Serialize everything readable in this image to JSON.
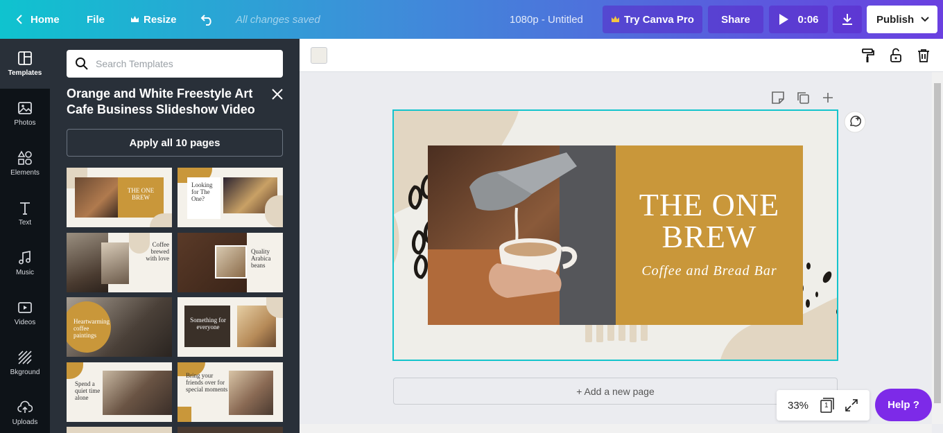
{
  "topbar": {
    "home": "Home",
    "file": "File",
    "resize": "Resize",
    "saved_status": "All changes saved",
    "doc_title": "1080p - Untitled",
    "try_pro": "Try Canva Pro",
    "share": "Share",
    "play_time": "0:06",
    "publish": "Publish"
  },
  "rail": {
    "items": [
      {
        "label": "Templates",
        "icon": "templates-icon"
      },
      {
        "label": "Photos",
        "icon": "photos-icon"
      },
      {
        "label": "Elements",
        "icon": "elements-icon"
      },
      {
        "label": "Text",
        "icon": "text-icon"
      },
      {
        "label": "Music",
        "icon": "music-icon"
      },
      {
        "label": "Videos",
        "icon": "videos-icon"
      },
      {
        "label": "Bkground",
        "icon": "background-icon"
      },
      {
        "label": "Uploads",
        "icon": "uploads-icon"
      }
    ]
  },
  "panel": {
    "search_placeholder": "Search Templates",
    "template_title": "Orange and White Freestyle Art Cafe Business Slideshow Video",
    "apply_label": "Apply all 10 pages",
    "thumbs": [
      {
        "text": "THE ONE BREW"
      },
      {
        "text": "Looking for The One?"
      },
      {
        "text": "Coffee brewed with love"
      },
      {
        "text": "Quality Arabica beans"
      },
      {
        "text": "Heartwarming coffee paintings"
      },
      {
        "text": "Something for everyone"
      },
      {
        "text": "Spend a quiet time alone"
      },
      {
        "text": "Bring your friends over for special moments"
      }
    ]
  },
  "slide": {
    "title": "THE ONE BREW",
    "subtitle": "Coffee and Bread Bar"
  },
  "editor": {
    "add_page": "+ Add a new page",
    "zoom": "33%",
    "page_count": "1",
    "help": "Help ?"
  },
  "colors": {
    "accent": "#13c4cc",
    "gold": "#c9973a",
    "help": "#7d2ae8"
  }
}
